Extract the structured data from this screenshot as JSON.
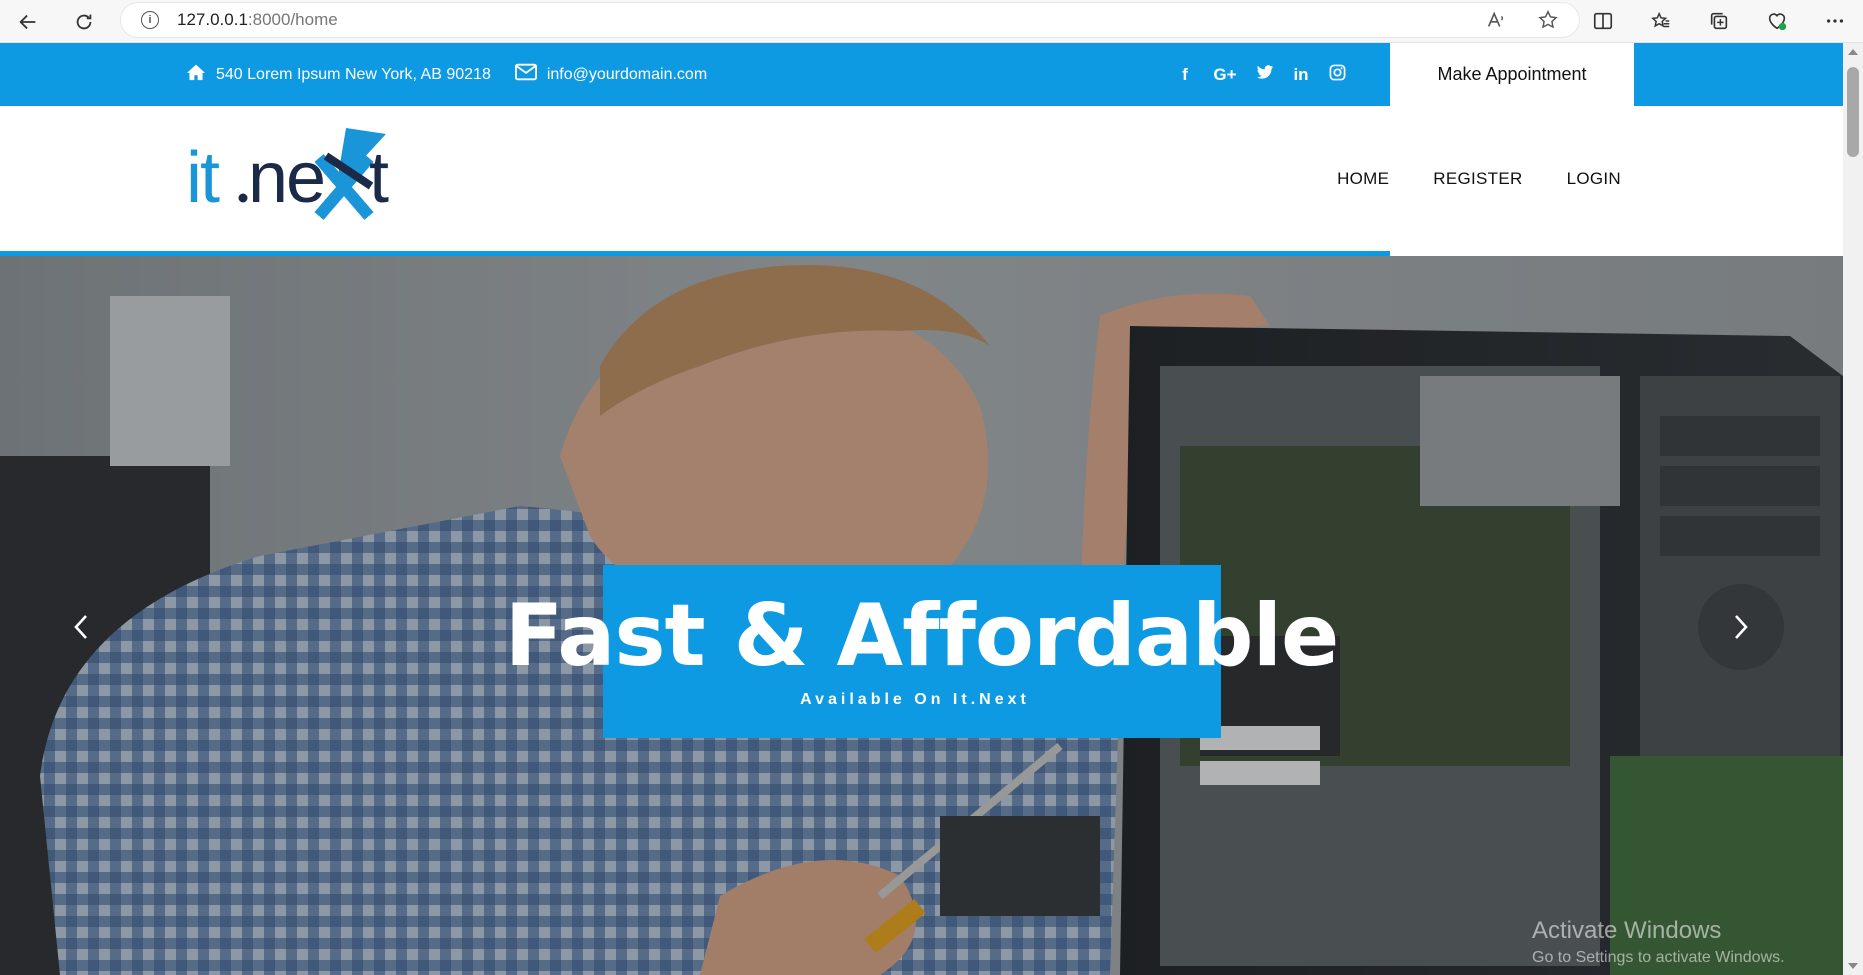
{
  "browser": {
    "url_host": "127.0.0.1",
    "url_path": ":8000/home",
    "icons": [
      "back-icon",
      "refresh-icon",
      "info-icon",
      "read-aloud-icon",
      "favorite-star-icon",
      "split-screen-icon",
      "favorites-icon",
      "collections-icon",
      "health-icon",
      "more-icon"
    ]
  },
  "topbar": {
    "address": "540 Lorem Ipsum New York, AB 90218",
    "email": "info@yourdomain.com",
    "socials": [
      "f",
      "G+",
      "t",
      "in",
      "ig"
    ],
    "appointment_label": "Make Appointment",
    "accent_color": "#0d9ae2"
  },
  "header": {
    "logo_text": "it.next",
    "menu": [
      {
        "label": "HOME"
      },
      {
        "label": "REGISTER"
      },
      {
        "label": "LOGIN"
      }
    ]
  },
  "hero": {
    "title": "Fast & Affordable",
    "subtitle": "Available On It.Next",
    "prev_label": "‹",
    "next_label": "›"
  },
  "watermark": {
    "line1": "Activate Windows",
    "line2": "Go to Settings to activate Windows."
  }
}
